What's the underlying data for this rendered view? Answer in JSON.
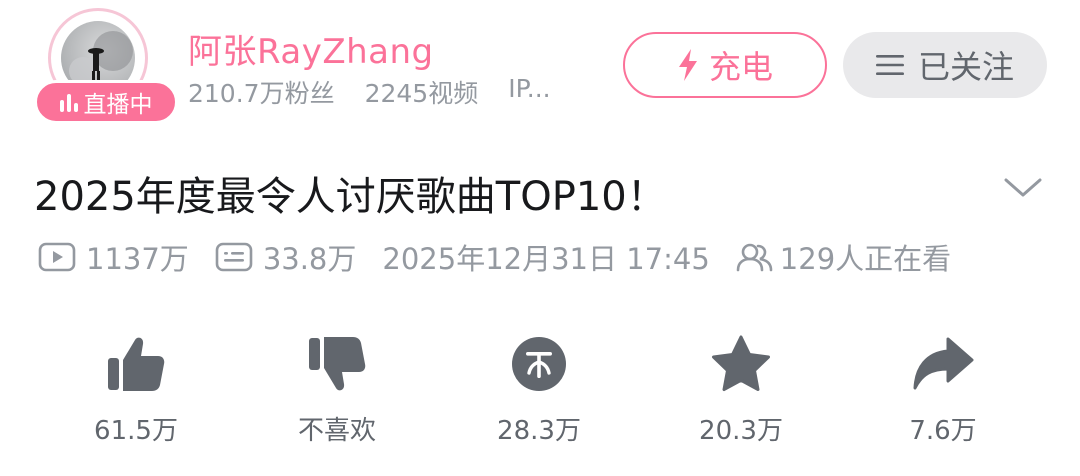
{
  "uploader": {
    "name": "阿张RayZhang",
    "followers": "210.7万粉丝",
    "videos": "2245视频",
    "ip": "IP...",
    "live_badge": "直播中"
  },
  "buttons": {
    "charge_label": "充电",
    "follow_label": "已关注"
  },
  "video": {
    "title": "2025年度最令人讨厌歌曲TOP10！",
    "views": "1137万",
    "danmaku": "33.8万",
    "publish_time": "2025年12月31日 17:45",
    "watching_now": "129人正在看"
  },
  "actions": {
    "like": "61.5万",
    "dislike": "不喜欢",
    "coin": "28.3万",
    "favorite": "20.3万",
    "share": "7.6万"
  },
  "colors": {
    "accent_pink": "#fb7299",
    "icon_gray": "#61666d",
    "meta_gray": "#9499a0"
  }
}
